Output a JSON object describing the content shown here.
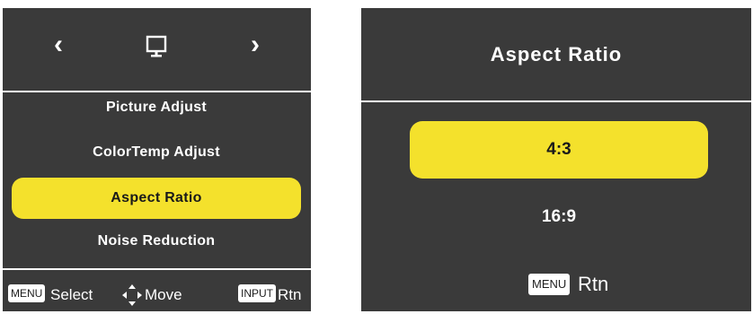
{
  "left_menu": {
    "header": {
      "left_arrow": "‹",
      "right_arrow": "›",
      "icon": "monitor-icon"
    },
    "items": [
      {
        "label": "Picture Adjust",
        "selected": false
      },
      {
        "label": "ColorTemp Adjust",
        "selected": false
      },
      {
        "label": "Aspect Ratio",
        "selected": true
      },
      {
        "label": "Noise Reduction",
        "selected": false
      }
    ],
    "footer": {
      "menu_key": "MENU",
      "select_label": "Select",
      "move_icon": "four-way-arrow-icon",
      "move_label": "Move",
      "input_key": "INPUT",
      "rtn_label": "Rtn"
    }
  },
  "submenu": {
    "title": "Aspect Ratio",
    "options": [
      {
        "label": "4:3",
        "selected": true
      },
      {
        "label": "16:9",
        "selected": false
      }
    ],
    "footer": {
      "menu_key": "MENU",
      "rtn_label": "Rtn"
    }
  },
  "colors": {
    "panel_background": "#3a3a3a",
    "highlight": "#f4e12c",
    "text": "#ffffff"
  }
}
